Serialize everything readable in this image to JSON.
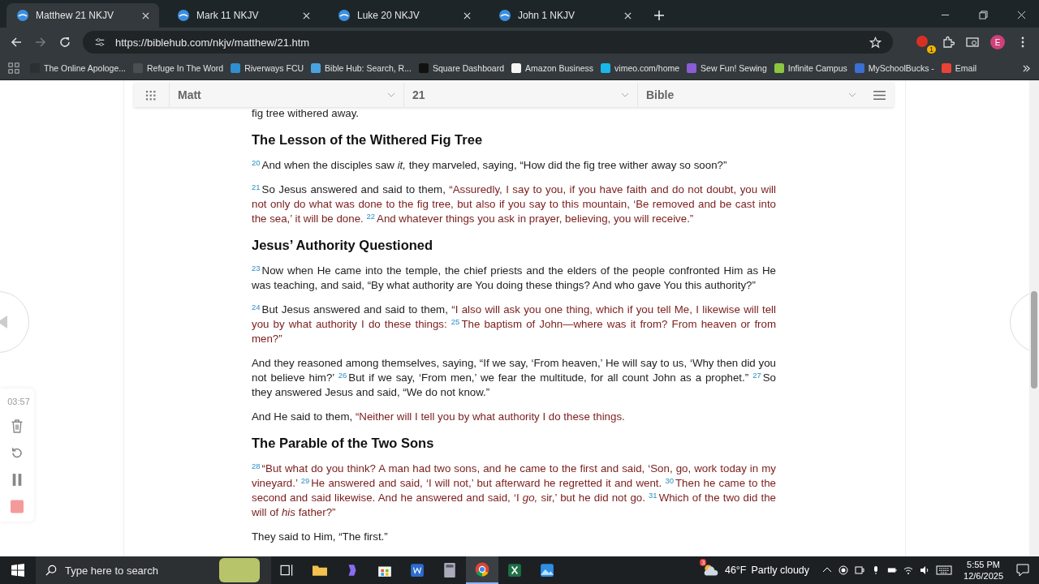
{
  "tabs": [
    {
      "title": "Matthew 21 NKJV",
      "selected": true
    },
    {
      "title": "Mark 11 NKJV",
      "selected": false
    },
    {
      "title": "Luke 20 NKJV",
      "selected": false
    },
    {
      "title": "John 1 NKJV",
      "selected": false
    }
  ],
  "address_bar": {
    "url": "https://biblehub.com/nkjv/matthew/21.htm"
  },
  "extension_badge": "1",
  "profile_initial": "E",
  "bookmarks": [
    {
      "label": "The Online Apologe...",
      "color": "#2b3033"
    },
    {
      "label": "Refuge In The Word",
      "color": "#4a4f52"
    },
    {
      "label": "Riverways FCU",
      "color": "#2f8fd0"
    },
    {
      "label": "Bible Hub: Search, R...",
      "color": "#4aa3e0"
    },
    {
      "label": "Square Dashboard",
      "color": "#111111"
    },
    {
      "label": "Amazon Business",
      "color": "#f5f5f5"
    },
    {
      "label": "vimeo.com/home",
      "color": "#1ab7ea"
    },
    {
      "label": "Sew Fun! Sewing",
      "color": "#8a5cd6"
    },
    {
      "label": "Infinite Campus",
      "color": "#8cc63f"
    },
    {
      "label": "MySchoolBucks -",
      "color": "#3b6fd1"
    },
    {
      "label": "Email",
      "color": "#ea4335"
    }
  ],
  "nav": {
    "book": "Matt",
    "chapter": "21",
    "version": "Bible"
  },
  "content": [
    {
      "kind": "text",
      "segments": [
        {
          "text": "fig tree withered away.",
          "red": false
        }
      ]
    },
    {
      "kind": "heading",
      "text": "The Lesson of the Withered Fig Tree"
    },
    {
      "kind": "text",
      "segments": [
        {
          "text": "$^{20}$And when the disciples saw *it,* they marveled, saying, “How did the fig tree wither away so soon?”",
          "red": false
        }
      ]
    },
    {
      "kind": "text",
      "segments": [
        {
          "text": "$^{21}$So Jesus answered and said to them, ",
          "red": false
        },
        {
          "text": "“Assuredly, I say to you, if you have faith and do not doubt, you will not only do what was done to the fig tree, but also if you say to this mountain, ‘Be removed and be cast into the sea,’ it will be done. $^{22}$And whatever things you ask in prayer, believing, you will receive.”",
          "red": true
        }
      ]
    },
    {
      "kind": "heading",
      "text": "Jesus’ Authority Questioned"
    },
    {
      "kind": "text",
      "segments": [
        {
          "text": "$^{23}$Now when He came into the temple, the chief priests and the elders of the people confronted Him as He was teaching, and said, “By what authority are You doing these things? And who gave You this authority?”",
          "red": false
        }
      ]
    },
    {
      "kind": "text",
      "segments": [
        {
          "text": "$^{24}$But Jesus answered and said to them, ",
          "red": false
        },
        {
          "text": "“I also will ask you one thing, which if you tell Me, I likewise will tell you by what authority I do these things: $^{25}$The baptism of John—where was it from? From heaven or from men?”",
          "red": true
        }
      ]
    },
    {
      "kind": "text",
      "segments": [
        {
          "text": "And they reasoned among themselves, saying, “If we say, ‘From heaven,’ He will say to us, ‘Why then did you not believe him?’ $^{26}$But if we say, ‘From men,’ we fear the multitude, for all count John as a prophet.” $^{27}$So they answered Jesus and said, “We do not know.”",
          "red": false
        }
      ]
    },
    {
      "kind": "text",
      "segments": [
        {
          "text": "And He said to them, ",
          "red": false
        },
        {
          "text": "“Neither will I tell you by what authority I do these things.",
          "red": true
        }
      ]
    },
    {
      "kind": "heading",
      "text": "The Parable of the Two Sons"
    },
    {
      "kind": "text",
      "segments": [
        {
          "text": "$^{28}$“But what do you think? A man had two sons, and he came to the first and said, ‘Son, go, work today in my vineyard.’ $^{29}$He answered and said, ‘I will not,’ but afterward he regretted it and went. $^{30}$Then he came to the second and said likewise. And he answered and said, ‘I *go,* sir,’ but he did not go. $^{31}$Which of the two did the will of *his* father?”",
          "red": true
        }
      ]
    },
    {
      "kind": "text",
      "segments": [
        {
          "text": "They said to Him, “The first.”",
          "red": false
        }
      ]
    }
  ],
  "recorder": {
    "timer": "03:57"
  },
  "taskbar": {
    "search_placeholder": "Type here to search",
    "weather_badge": "3",
    "temperature": "46°F",
    "weather": "Partly cloudy",
    "time": "5:55 PM",
    "date": "12/6/2025"
  }
}
